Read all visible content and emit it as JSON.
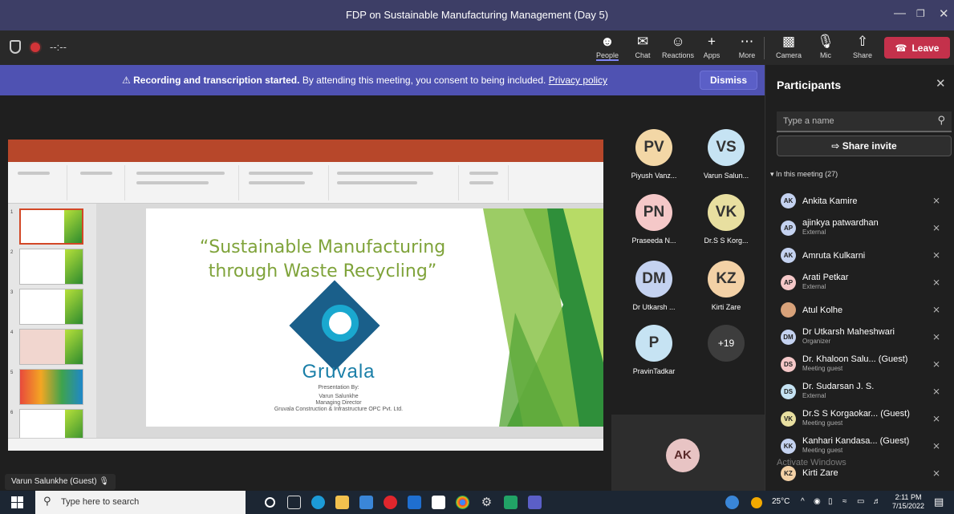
{
  "window": {
    "title": "FDP on Sustainable Manufacturing Management (Day 5)"
  },
  "meeting_timer": "--:--",
  "toolbar": {
    "people": "People",
    "chat": "Chat",
    "reactions": "Reactions",
    "apps": "Apps",
    "more": "More",
    "camera": "Camera",
    "mic": "Mic",
    "share": "Share",
    "leave": "Leave"
  },
  "banner": {
    "bold": "Recording and transcription started.",
    "text": " By attending this meeting, you consent to being included. ",
    "link": "Privacy policy",
    "dismiss": "Dismiss"
  },
  "slide": {
    "title_line1": "“Sustainable Manufacturing",
    "title_line2": "through Waste Recycling”",
    "brand": "Gruvala",
    "presented_by": "Presentation By:",
    "presenter": "Varun Salunkhe",
    "role": "Managing Director",
    "company": "Gruvala Construction & Infrastructure OPC Pvt. Ltd."
  },
  "presenter_tag": "Varun Salunkhe (Guest)",
  "gallery": [
    {
      "initials": "PV",
      "name": "Piyush Vanz...",
      "color": "#f3d7a6"
    },
    {
      "initials": "VS",
      "name": "Varun Salun...",
      "color": "#c6e3f3"
    },
    {
      "initials": "PN",
      "name": "Praseeda N...",
      "color": "#f5c8c8"
    },
    {
      "initials": "VK",
      "name": "Dr.S S Korg...",
      "color": "#e8dfa0"
    },
    {
      "initials": "DM",
      "name": "Dr Utkarsh ...",
      "color": "#c4d2f0"
    },
    {
      "initials": "KZ",
      "name": "Kirti Zare",
      "color": "#f3d1a6"
    },
    {
      "initials": "P",
      "name": "PravinTadkar",
      "color": "#c6e3f3"
    },
    {
      "initials": "+19",
      "name": ""
    }
  ],
  "self_view": {
    "initials": "AK"
  },
  "panel": {
    "title": "Participants",
    "search_placeholder": "Type a name",
    "share_invite": "Share invite",
    "section": "In this meeting (27)",
    "participants": [
      {
        "initials": "AK",
        "name": "Ankita Kamire",
        "sub": "",
        "color": "#c4d2f0"
      },
      {
        "initials": "AP",
        "name": "ajinkya patwardhan",
        "sub": "External",
        "color": "#c4d2f0"
      },
      {
        "initials": "AK",
        "name": "Amruta Kulkarni",
        "sub": "",
        "color": "#c4d2f0"
      },
      {
        "initials": "AP",
        "name": "Arati Petkar",
        "sub": "External",
        "color": "#f5c8c8"
      },
      {
        "initials": "",
        "name": "Atul Kolhe",
        "sub": "",
        "color": "#d8a27a"
      },
      {
        "initials": "DM",
        "name": "Dr Utkarsh Maheshwari",
        "sub": "Organizer",
        "color": "#c4d2f0"
      },
      {
        "initials": "DS",
        "name": "Dr. Khaloon Salu... (Guest)",
        "sub": "Meeting guest",
        "color": "#f5c8c8"
      },
      {
        "initials": "DS",
        "name": "Dr. Sudarsan J. S.",
        "sub": "External",
        "color": "#c6e3f3"
      },
      {
        "initials": "VK",
        "name": "Dr.S S Korgaokar... (Guest)",
        "sub": "Meeting guest",
        "color": "#e8dfa0"
      },
      {
        "initials": "KK",
        "name": "Kanhari Kandasa... (Guest)",
        "sub": "Meeting guest",
        "color": "#c4d2f0"
      },
      {
        "initials": "KZ",
        "name": "Kirti Zare",
        "sub": "",
        "color": "#f3d1a6"
      }
    ],
    "watermark": "Activate Windows"
  },
  "taskbar": {
    "search_placeholder": "Type here to search",
    "temperature": "25°C",
    "time": "2:11 PM",
    "date": "7/15/2022"
  }
}
